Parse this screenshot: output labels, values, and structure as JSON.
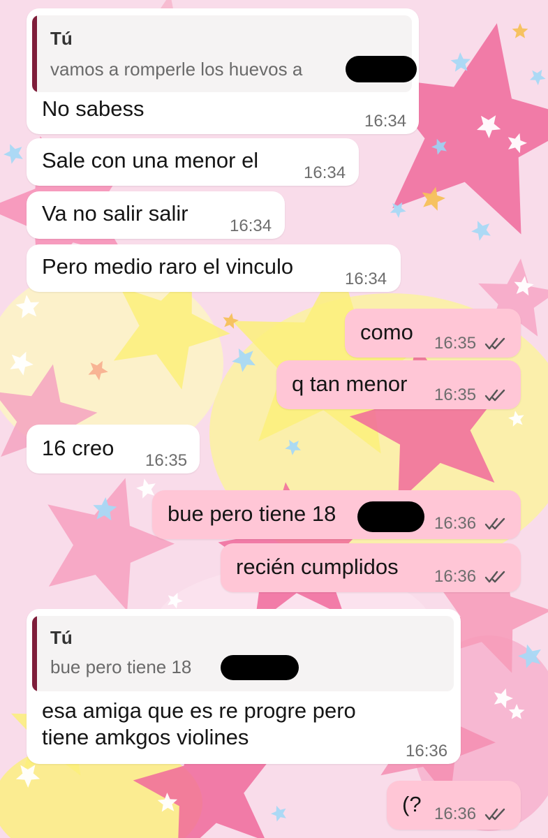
{
  "colors": {
    "incoming_bubble": "#ffffff",
    "outgoing_bubble": "#ffc6d6",
    "quote_bar": "#7e1d3a",
    "wallpaper_pink": "#f06a9b",
    "wallpaper_yellow": "#fbf07a"
  },
  "messages": [
    {
      "direction": "in",
      "reply": {
        "author": "Tú",
        "text": "vamos a romperle los huevos a"
      },
      "text": "No sabess",
      "time": "16:34"
    },
    {
      "direction": "in",
      "text": "Sale con una menor el",
      "time": "16:34"
    },
    {
      "direction": "in",
      "text": "Va no salir salir",
      "time": "16:34"
    },
    {
      "direction": "in",
      "text": "Pero medio raro el vinculo",
      "time": "16:34"
    },
    {
      "direction": "out",
      "text": "como",
      "time": "16:35",
      "status": "read"
    },
    {
      "direction": "out",
      "text": "q tan menor",
      "time": "16:35",
      "status": "read"
    },
    {
      "direction": "in",
      "text": "16 creo",
      "time": "16:35"
    },
    {
      "direction": "out",
      "text": "bue pero tiene 18",
      "time": "16:36",
      "status": "read"
    },
    {
      "direction": "out",
      "text": "recién cumplidos",
      "time": "16:36",
      "status": "read"
    },
    {
      "direction": "in",
      "reply": {
        "author": "Tú",
        "text": "bue pero tiene 18"
      },
      "text_line1": "esa amiga que es re progre pero",
      "text_line2": "tiene amkgos violines",
      "time": "16:36"
    },
    {
      "direction": "out",
      "text": "(?",
      "time": "16:36",
      "status": "read"
    }
  ]
}
